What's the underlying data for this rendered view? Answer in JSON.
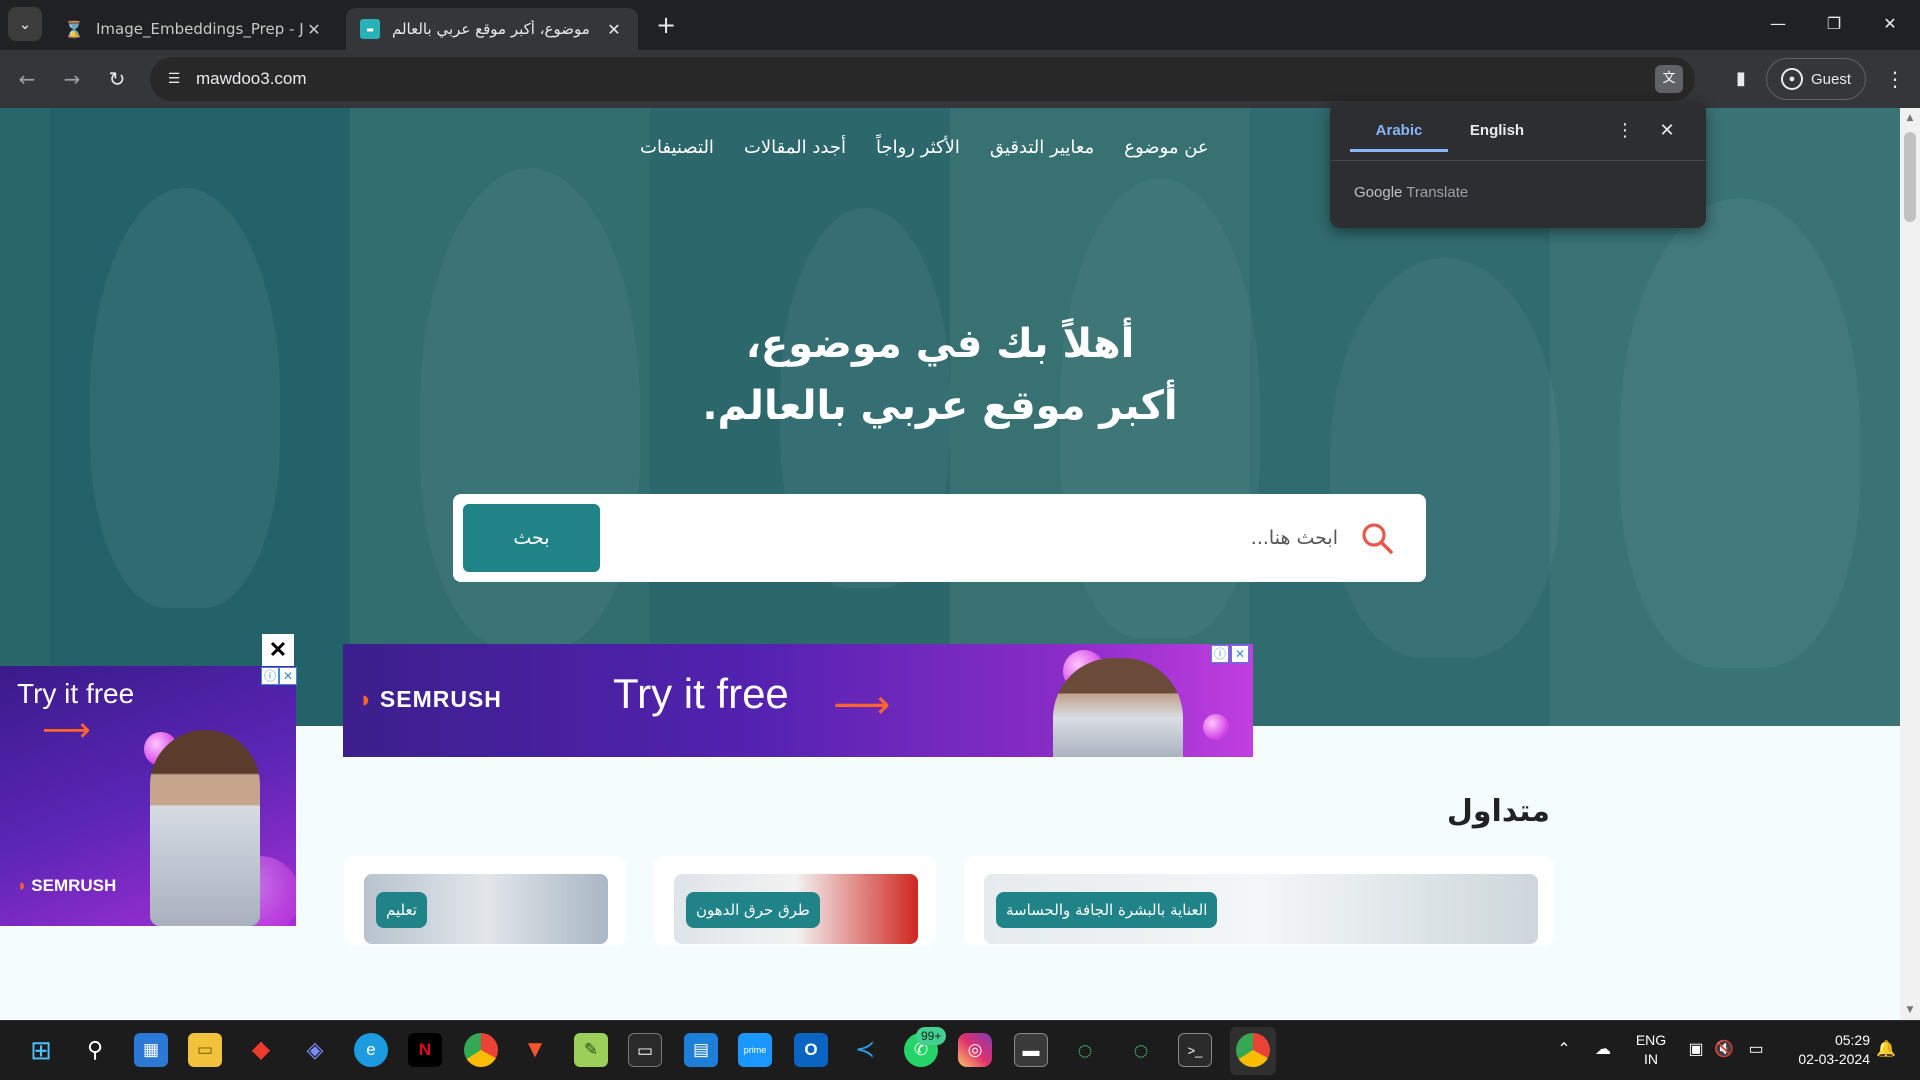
{
  "browser": {
    "tabs": [
      {
        "title": "Image_Embeddings_Prep - Jupy",
        "icon": "hourglass-icon"
      },
      {
        "title": "موضوع، أكبر موقع عربي بالعالم",
        "icon": "mawdoo3-favicon"
      }
    ],
    "url": "mawdoo3.com",
    "profile_label": "Guest"
  },
  "translate_popup": {
    "tabs": [
      "Arabic",
      "English"
    ],
    "selected": "Arabic",
    "brand_google": "Google",
    "brand_translate": " Translate"
  },
  "site": {
    "nav": [
      "التصنيفات",
      "أجدد المقالات",
      "الأكثر رواجاً",
      "معايير التدقيق",
      "عن موضوع"
    ],
    "hero_line1": "أهلاً بك في موضوع،",
    "hero_line2": "أكبر موقع عربي بالعالم.",
    "search_placeholder": "ابحث هنا...",
    "search_button": "بحث",
    "section_title": "متداول",
    "cards": [
      {
        "tag": "تعليم"
      },
      {
        "tag": "طرق حرق الدهون"
      },
      {
        "tag": "العناية بالبشرة الجافة والحساسة"
      }
    ],
    "accent_color": "#1f8387"
  },
  "ads": {
    "banner": {
      "brand": "SEMRUSH",
      "cta": "Try it free"
    },
    "side": {
      "brand": "SEMRUSH",
      "cta": "Try it free",
      "close": "✕"
    },
    "info_mark": "ⓘ",
    "close_mark": "✕"
  },
  "taskbar": {
    "whatsapp_badge": "99+",
    "lang_line1": "ENG",
    "lang_line2": "IN",
    "time": "05:29",
    "date": "02-03-2024"
  }
}
